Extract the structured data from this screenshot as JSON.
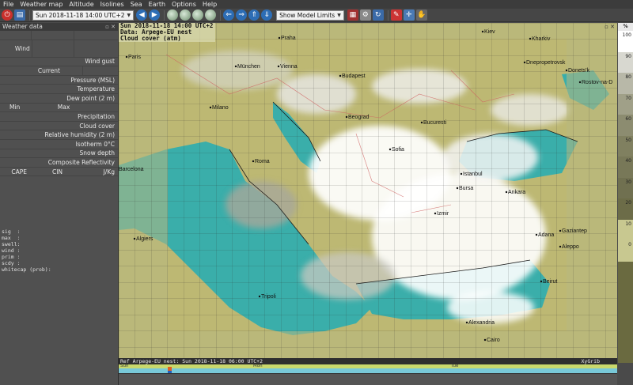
{
  "menu": [
    "File",
    "Weather map",
    "Altitude",
    "Isolines",
    "Sea",
    "Earth",
    "Options",
    "Help"
  ],
  "toolbar": {
    "date_select": "Sun 2018-11-18 14:00 UTC+2",
    "model_limits": "Show Model Limits"
  },
  "dock": {
    "title": "Weather data",
    "rows": {
      "wind": "Wind",
      "wind_gust": "Wind gust",
      "current": "Current",
      "pressure": "Pressure (MSL)",
      "temperature": "Temperature",
      "dew_point": "Dew point (2 m)",
      "min": "Min",
      "max": "Max",
      "precipitation": "Precipitation",
      "cloud_cover": "Cloud cover",
      "rel_humidity": "Relative humidity (2 m)",
      "isotherm": "Isotherm 0°C",
      "snow_depth": "Snow depth",
      "composite_refl": "Composite Reflectivity",
      "cape": "CAPE",
      "cin": "CIN",
      "jkg": "J/Kg"
    },
    "info_lines": [
      "sig  :",
      "max  :",
      "swell:",
      "wind :",
      "prim :",
      "scdy :",
      "whitecap (prob):"
    ]
  },
  "map": {
    "header_line1": "Sun 2018-11-18 14:00 UTC+2",
    "header_line2": "Data: Arpege-EU nest",
    "header_line3": "Cloud cover (atm)",
    "cities": [
      {
        "name": "Praha"
      },
      {
        "name": "Kiev"
      },
      {
        "name": "Kharkiv"
      },
      {
        "name": "Paris"
      },
      {
        "name": "München"
      },
      {
        "name": "Vienna"
      },
      {
        "name": "Dnepropetrovsk"
      },
      {
        "name": "Donets'k"
      },
      {
        "name": "Budapest"
      },
      {
        "name": "Rostov-na-D"
      },
      {
        "name": "Milano"
      },
      {
        "name": "Beograd"
      },
      {
        "name": "Bucuresti"
      },
      {
        "name": "Sofia"
      },
      {
        "name": "Roma"
      },
      {
        "name": "Barcelona"
      },
      {
        "name": "Istanbul"
      },
      {
        "name": "Bursa"
      },
      {
        "name": "Ankara"
      },
      {
        "name": "Izmir"
      },
      {
        "name": "Algiers"
      },
      {
        "name": "Adana"
      },
      {
        "name": "Gaziantep"
      },
      {
        "name": "Aleppo"
      },
      {
        "name": "Tripoli"
      },
      {
        "name": "Beirut"
      },
      {
        "name": "Alexandria"
      },
      {
        "name": "Cairo"
      }
    ]
  },
  "legend": {
    "unit": "%",
    "values": [
      "100",
      "90",
      "80",
      "70",
      "60",
      "50",
      "40",
      "30",
      "20",
      "10",
      "0"
    ],
    "colors": [
      "#ffffff",
      "#d8d8d0",
      "#b8b8a8",
      "#a0a088",
      "#8c8c70",
      "#808060",
      "#787858",
      "#707050",
      "#6c6c48",
      "#c8c890",
      "#c8c890"
    ]
  },
  "status": {
    "text": "Ref Arpege-EU nest: Sun 2018-11-18 06:00 UTC+2",
    "app_name": "XyGrib"
  },
  "timeline": {
    "days": [
      "Sun",
      "Mon",
      "Tue"
    ]
  }
}
